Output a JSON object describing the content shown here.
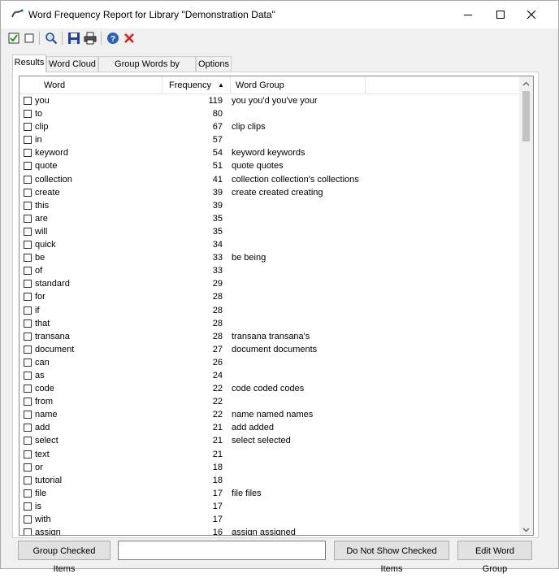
{
  "window": {
    "title": "Word Frequency Report for Library \"Demonstration Data\"",
    "minimize_icon": "minimize-icon",
    "maximize_icon": "maximize-icon",
    "close_icon": "close-icon"
  },
  "toolbar": {
    "icons": [
      "check-all-icon",
      "uncheck-all-icon",
      "search-icon",
      "save-icon",
      "print-icon",
      "help-icon",
      "exit-icon"
    ]
  },
  "tabs": [
    {
      "label": "Results",
      "active": true
    },
    {
      "label": "Word Cloud",
      "active": false
    },
    {
      "label": "Group Words by Pattern",
      "active": false
    },
    {
      "label": "Options",
      "active": false
    }
  ],
  "table": {
    "headers": {
      "word": "Word",
      "frequency": "Frequency",
      "sort_indicator": "▲",
      "group": "Word Group"
    },
    "rows": [
      {
        "word": "you",
        "freq": "119",
        "group": "you you'd you've your"
      },
      {
        "word": "to",
        "freq": "80",
        "group": ""
      },
      {
        "word": "clip",
        "freq": "67",
        "group": "clip clips"
      },
      {
        "word": "in",
        "freq": "57",
        "group": ""
      },
      {
        "word": "keyword",
        "freq": "54",
        "group": "keyword keywords"
      },
      {
        "word": "quote",
        "freq": "51",
        "group": "quote quotes"
      },
      {
        "word": "collection",
        "freq": "41",
        "group": "collection collection's collections"
      },
      {
        "word": "create",
        "freq": "39",
        "group": "create created creating"
      },
      {
        "word": "this",
        "freq": "39",
        "group": ""
      },
      {
        "word": "are",
        "freq": "35",
        "group": ""
      },
      {
        "word": "will",
        "freq": "35",
        "group": ""
      },
      {
        "word": "quick",
        "freq": "34",
        "group": ""
      },
      {
        "word": "be",
        "freq": "33",
        "group": "be being"
      },
      {
        "word": "of",
        "freq": "33",
        "group": ""
      },
      {
        "word": "standard",
        "freq": "29",
        "group": ""
      },
      {
        "word": "for",
        "freq": "28",
        "group": ""
      },
      {
        "word": "if",
        "freq": "28",
        "group": ""
      },
      {
        "word": "that",
        "freq": "28",
        "group": ""
      },
      {
        "word": "transana",
        "freq": "28",
        "group": "transana transana's"
      },
      {
        "word": "document",
        "freq": "27",
        "group": "document documents"
      },
      {
        "word": "can",
        "freq": "26",
        "group": ""
      },
      {
        "word": "as",
        "freq": "24",
        "group": ""
      },
      {
        "word": "code",
        "freq": "22",
        "group": "code coded codes"
      },
      {
        "word": "from",
        "freq": "22",
        "group": ""
      },
      {
        "word": "name",
        "freq": "22",
        "group": "name named names"
      },
      {
        "word": "add",
        "freq": "21",
        "group": "add added"
      },
      {
        "word": "select",
        "freq": "21",
        "group": "select selected"
      },
      {
        "word": "text",
        "freq": "21",
        "group": ""
      },
      {
        "word": "or",
        "freq": "18",
        "group": ""
      },
      {
        "word": "tutorial",
        "freq": "18",
        "group": ""
      },
      {
        "word": "file",
        "freq": "17",
        "group": "file files"
      },
      {
        "word": "is",
        "freq": "17",
        "group": ""
      },
      {
        "word": "with",
        "freq": "17",
        "group": ""
      },
      {
        "word": "assign",
        "freq": "16",
        "group": "assign assigned"
      }
    ]
  },
  "bottom": {
    "group_checked_label": "Group Checked Items",
    "group_name_value": "",
    "do_not_show_label": "Do Not Show Checked Items",
    "edit_group_label": "Edit Word Group"
  }
}
